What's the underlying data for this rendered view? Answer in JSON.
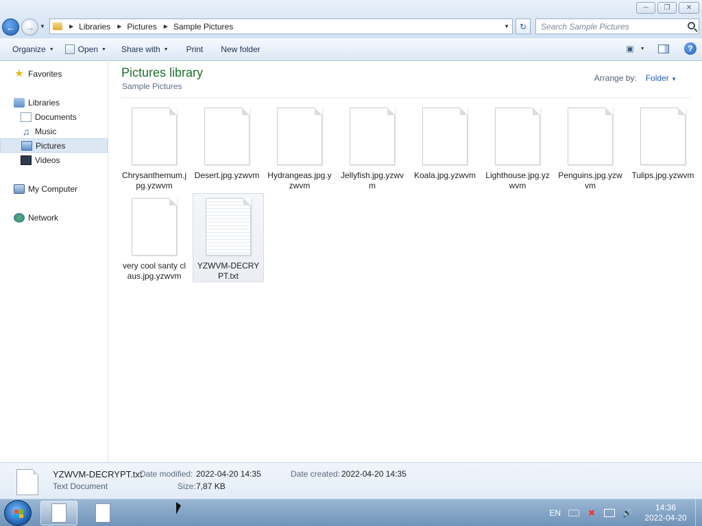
{
  "address": {
    "crumbs": [
      "Libraries",
      "Pictures",
      "Sample Pictures"
    ],
    "search_placeholder": "Search Sample Pictures"
  },
  "toolbar": {
    "organize": "Organize",
    "open": "Open",
    "share_with": "Share with",
    "print": "Print",
    "new_folder": "New folder"
  },
  "nav": {
    "favorites": "Favorites",
    "libraries": "Libraries",
    "documents": "Documents",
    "music": "Music",
    "pictures": "Pictures",
    "videos": "Videos",
    "my_computer": "My Computer",
    "network": "Network"
  },
  "library": {
    "title": "Pictures library",
    "subtitle": "Sample Pictures",
    "arrange_label": "Arrange by:",
    "arrange_value": "Folder"
  },
  "files": [
    {
      "name": "Chrysanthemum.jpg.yzwvm"
    },
    {
      "name": "Desert.jpg.yzwvm"
    },
    {
      "name": "Hydrangeas.jpg.yzwvm"
    },
    {
      "name": "Jellyfish.jpg.yzwvm"
    },
    {
      "name": "Koala.jpg.yzwvm"
    },
    {
      "name": "Lighthouse.jpg.yzwvm"
    },
    {
      "name": "Penguins.jpg.yzwvm"
    },
    {
      "name": "Tulips.jpg.yzwvm"
    },
    {
      "name": "very cool santy claus.jpg.yzwvm"
    },
    {
      "name": "YZWVM-DECRYPT.txt"
    }
  ],
  "details": {
    "filename": "YZWVM-DECRYPT.txt",
    "type": "Text Document",
    "date_modified_label": "Date modified:",
    "date_modified": "2022-04-20 14:35",
    "date_created_label": "Date created:",
    "date_created": "2022-04-20 14:35",
    "size_label": "Size:",
    "size": "7,87 KB"
  },
  "taskbar": {
    "language": "EN",
    "time": "14:36",
    "date": "2022-04-20"
  }
}
